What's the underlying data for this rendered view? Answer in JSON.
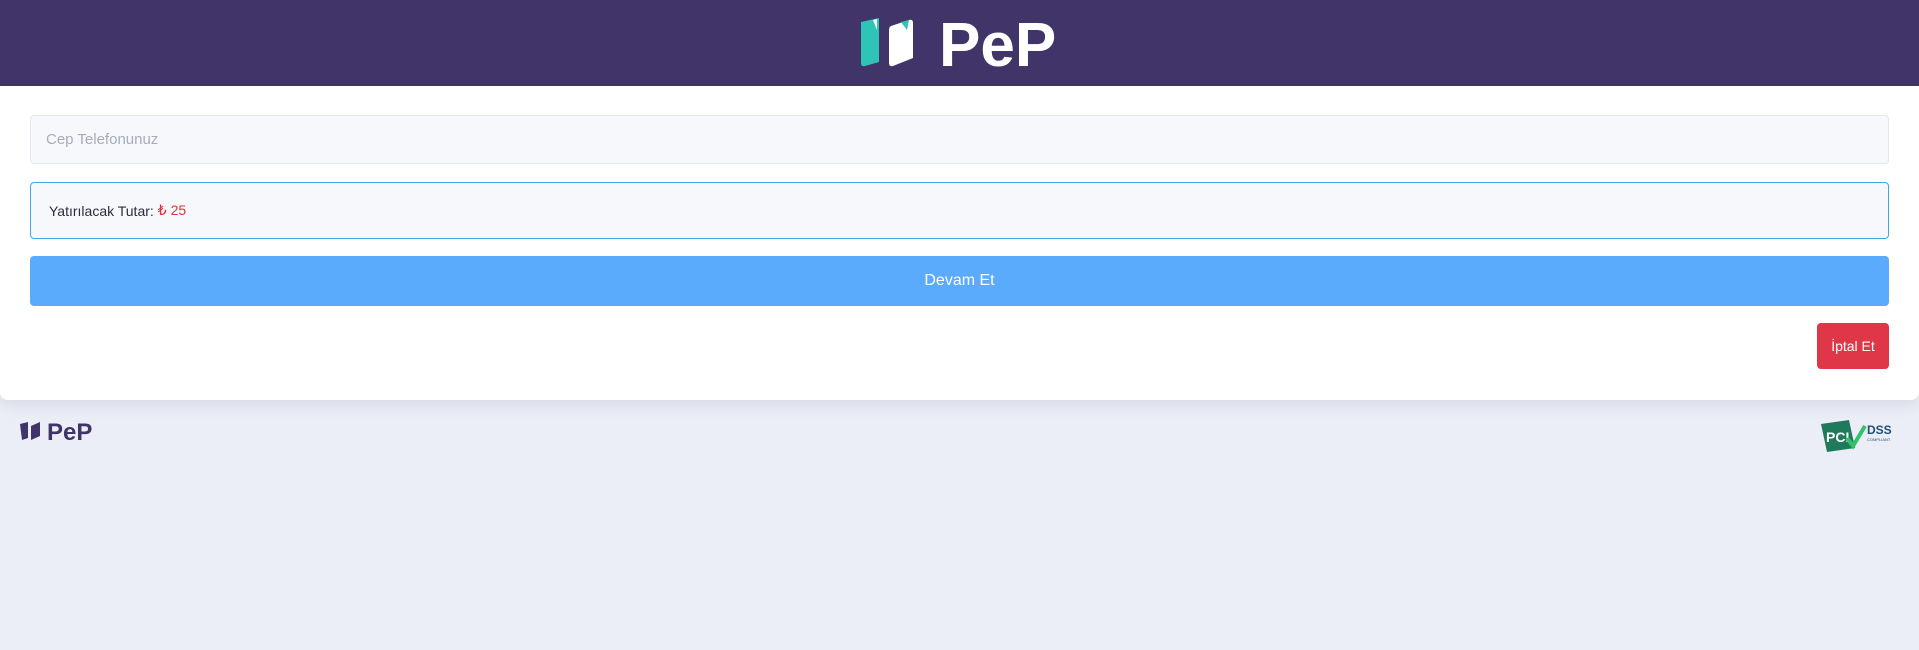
{
  "header": {
    "logo_text": "PeP"
  },
  "form": {
    "phone": {
      "placeholder": "Cep Telefonunuz",
      "value": ""
    },
    "amount": {
      "label": "Yatırılacak Tutar:",
      "value": "₺ 25"
    },
    "continue_label": "Devam Et",
    "cancel_label": "İptal Et"
  },
  "footer": {
    "logo_text": "PeP",
    "badge_text": "PCI DSS",
    "badge_subtext": "COMPLIANT"
  },
  "colors": {
    "header_bg": "#403468",
    "accent_teal": "#2ec4b6",
    "primary_button": "#5aabfb",
    "cancel_button": "#e03748",
    "amount_value": "#e0323c",
    "page_bg": "#ebeef6"
  },
  "icons": {
    "header_logo": "pep-logo",
    "footer_logo": "pep-logo-small",
    "badge": "pci-dss-badge"
  }
}
